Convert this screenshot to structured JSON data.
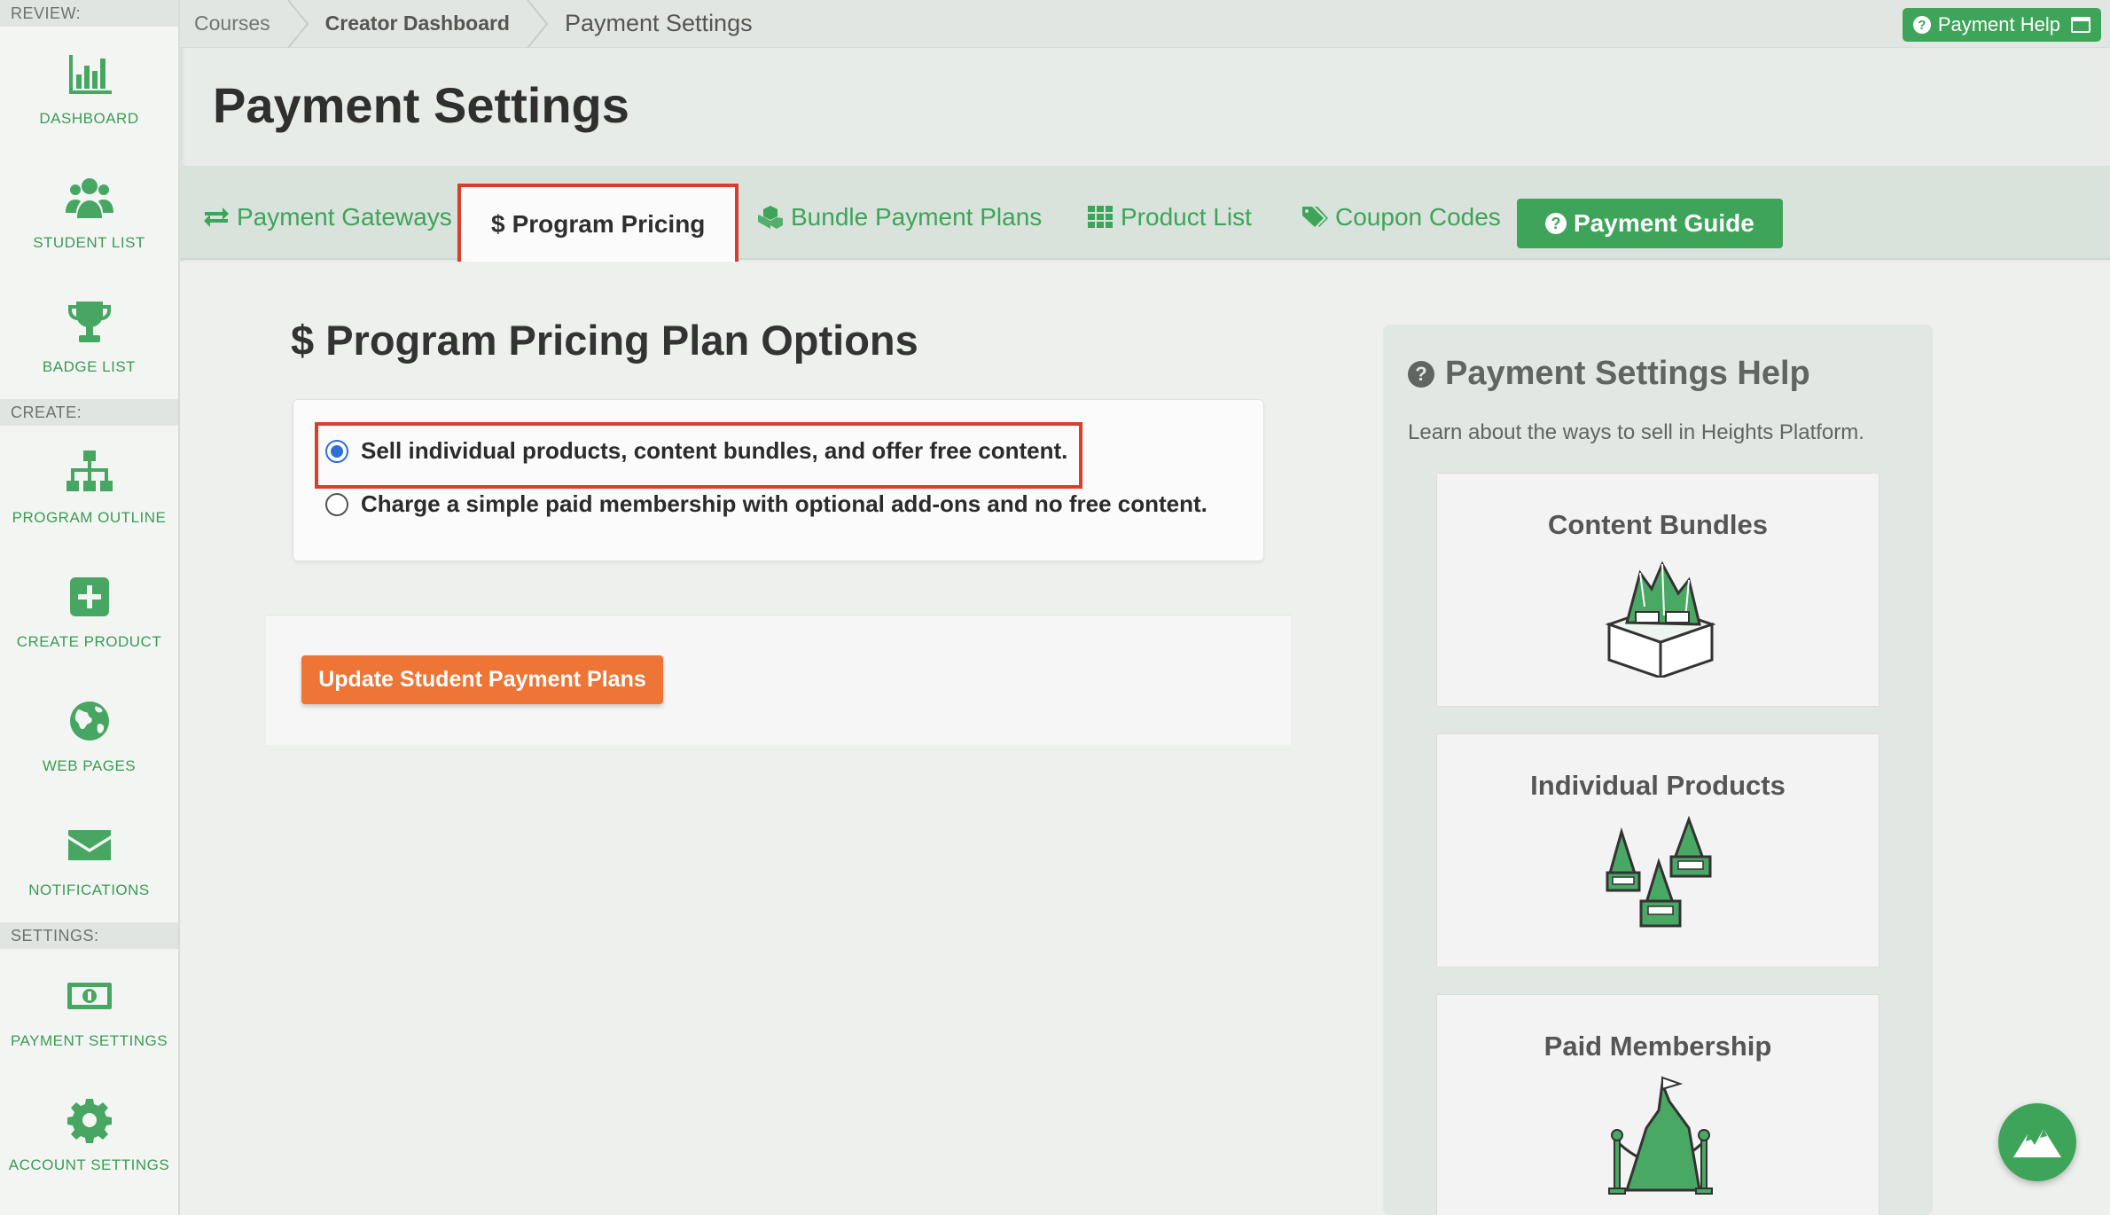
{
  "sidebar": {
    "sections": {
      "review": "REVIEW:",
      "create": "CREATE:",
      "settings": "SETTINGS:"
    },
    "items": [
      {
        "label": "DASHBOARD",
        "icon": "bar-chart-icon"
      },
      {
        "label": "STUDENT LIST",
        "icon": "users-icon"
      },
      {
        "label": "BADGE LIST",
        "icon": "trophy-icon"
      },
      {
        "label": "PROGRAM OUTLINE",
        "icon": "sitemap-icon"
      },
      {
        "label": "CREATE PRODUCT",
        "icon": "plus-square-icon"
      },
      {
        "label": "WEB PAGES",
        "icon": "globe-icon"
      },
      {
        "label": "NOTIFICATIONS",
        "icon": "envelope-icon"
      },
      {
        "label": "PAYMENT SETTINGS",
        "icon": "money-bill-icon"
      },
      {
        "label": "ACCOUNT SETTINGS",
        "icon": "gear-icon"
      }
    ]
  },
  "breadcrumb": {
    "items": [
      "Courses",
      "Creator Dashboard",
      "Payment Settings"
    ]
  },
  "help_button": {
    "label": "Payment Help"
  },
  "page": {
    "title": "Payment Settings"
  },
  "tabs": [
    {
      "label": "Payment Gateways",
      "icon": "exchange-icon"
    },
    {
      "label": "Program Pricing",
      "icon": "dollar-icon"
    },
    {
      "label": "Bundle Payment Plans",
      "icon": "cubes-icon"
    },
    {
      "label": "Product List",
      "icon": "grid-icon"
    },
    {
      "label": "Coupon Codes",
      "icon": "tags-icon"
    },
    {
      "label": "Payment Guide",
      "icon": "question-circle-icon"
    }
  ],
  "pricing": {
    "dollar": "$",
    "title": "Program Pricing Plan Options",
    "options": [
      {
        "label": "Sell individual products, content bundles, and offer free content.",
        "checked": true
      },
      {
        "label": "Charge a simple paid membership with optional add-ons and no free content.",
        "checked": false
      }
    ],
    "update_button": "Update Student Payment Plans"
  },
  "help_panel": {
    "title": "Payment Settings Help",
    "description": "Learn about the ways to sell in Heights Platform.",
    "cards": [
      {
        "title": "Content Bundles"
      },
      {
        "title": "Individual Products"
      },
      {
        "title": "Paid Membership"
      }
    ]
  },
  "colors": {
    "accent_green": "#3ea45a",
    "highlight_red": "#d93d2c",
    "update_orange": "#ee7536",
    "radio_blue": "#2f6fd4"
  }
}
